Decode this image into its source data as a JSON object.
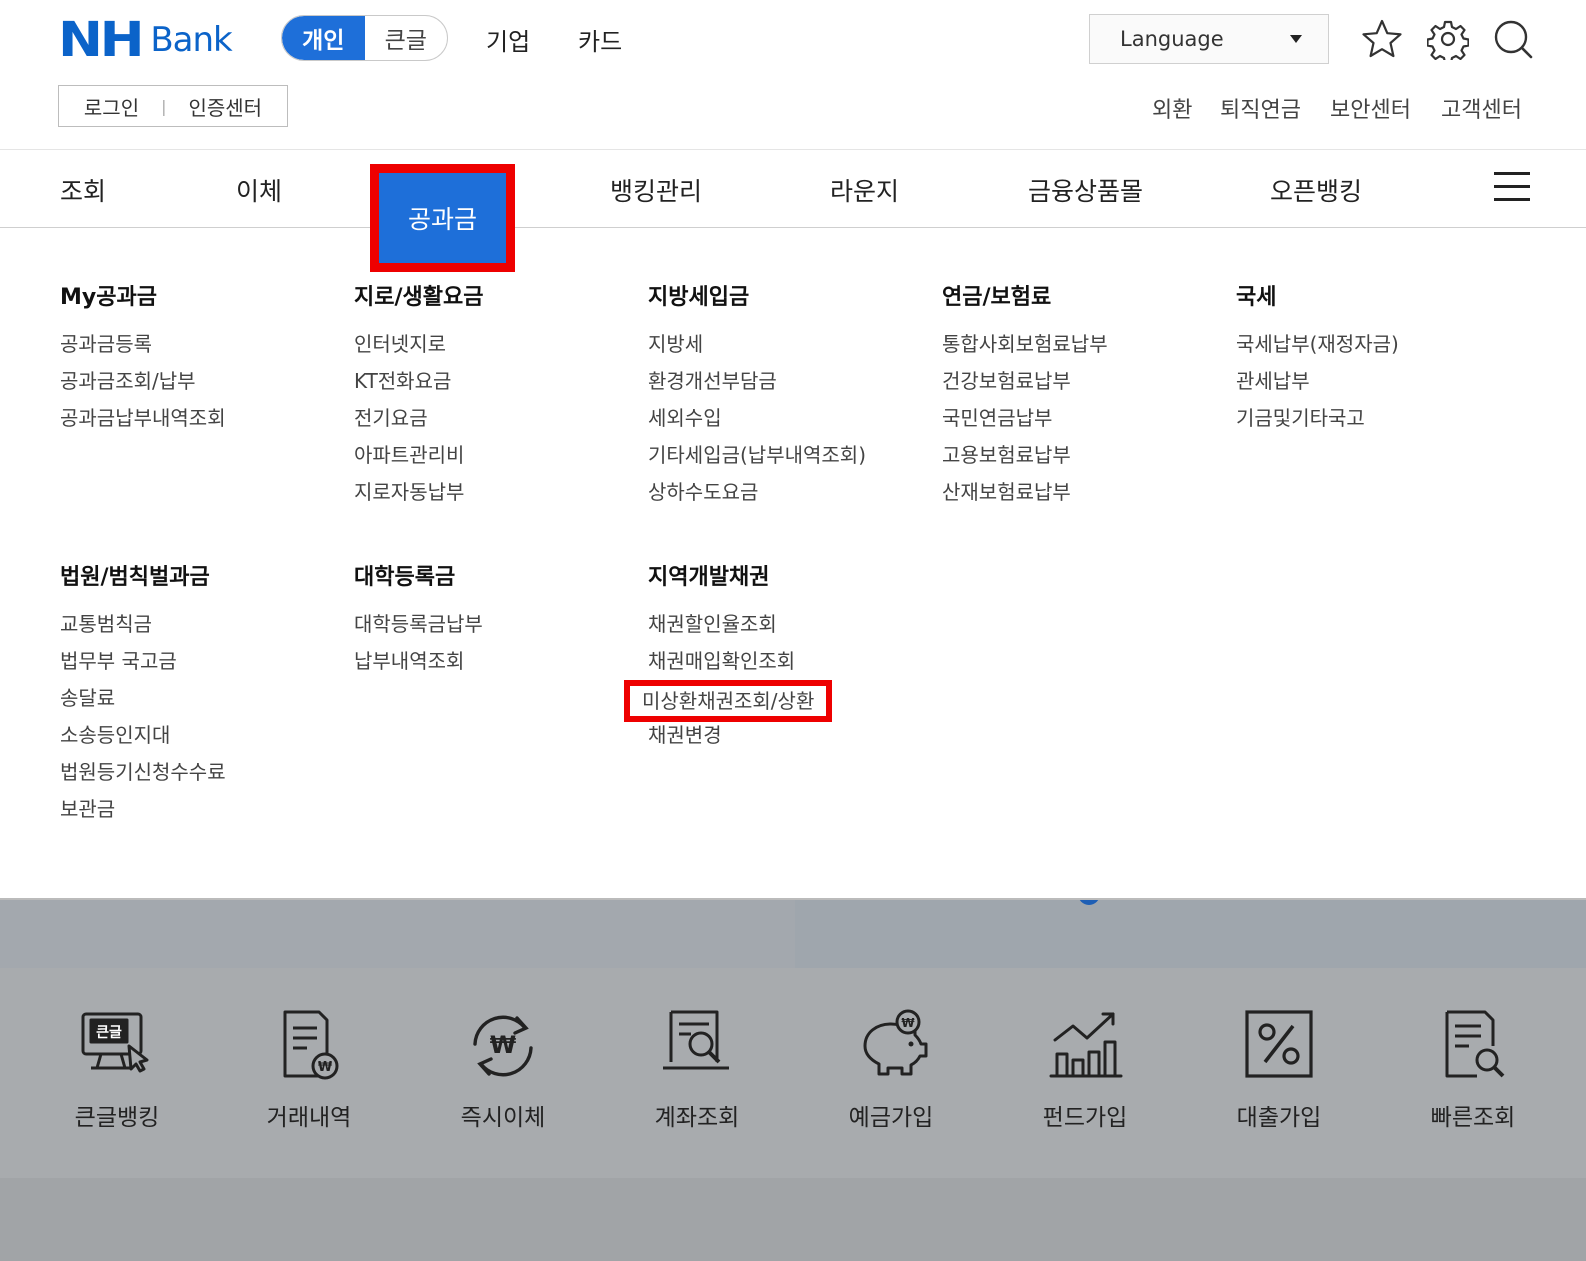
{
  "header": {
    "logo_nh": "NH",
    "logo_bank": "Bank",
    "segments": [
      "개인",
      "큰글"
    ],
    "top_nav": [
      "기업",
      "카드"
    ],
    "language": "Language",
    "icons": [
      "star-icon",
      "gear-icon",
      "search-icon"
    ],
    "login": "로그인",
    "cert_center": "인증센터",
    "util_links": [
      "외환",
      "퇴직연금",
      "보안센터",
      "고객센터"
    ]
  },
  "main_nav": {
    "items": [
      "조회",
      "이체",
      "공과금",
      "뱅킹관리",
      "라운지",
      "금융상품몰",
      "오픈뱅킹"
    ],
    "active": "공과금",
    "menu_icon": "hamburger-menu-icon"
  },
  "mega_menu": {
    "columns": [
      {
        "title": "My공과금",
        "items": [
          "공과금등록",
          "공과금조회/납부",
          "공과금납부내역조회"
        ]
      },
      {
        "title": "지로/생활요금",
        "items": [
          "인터넷지로",
          "KT전화요금",
          "전기요금",
          "아파트관리비",
          "지로자동납부"
        ]
      },
      {
        "title": "지방세입금",
        "items": [
          "지방세",
          "환경개선부담금",
          "세외수입",
          "기타세입금(납부내역조회)",
          "상하수도요금"
        ]
      },
      {
        "title": "연금/보험료",
        "items": [
          "통합사회보험료납부",
          "건강보험료납부",
          "국민연금납부",
          "고용보험료납부",
          "산재보험료납부"
        ]
      },
      {
        "title": "국세",
        "items": [
          "국세납부(재정자금)",
          "관세납부",
          "기금및기타국고"
        ]
      },
      {
        "title": "법원/범칙벌과금",
        "items": [
          "교통범칙금",
          "법무부 국고금",
          "송달료",
          "소송등인지대",
          "법원등기신청수수료",
          "보관금"
        ]
      },
      {
        "title": "대학등록금",
        "items": [
          "대학등록금납부",
          "납부내역조회"
        ]
      },
      {
        "title": "지역개발채권",
        "items": [
          "채권할인율조회",
          "채권매입확인조회",
          "미상환채권조회/상환",
          "채권변경"
        ]
      }
    ],
    "highlighted_item": "미상환채권조회/상환"
  },
  "quick_menu": [
    {
      "label": "큰글뱅킹",
      "icon": "large-text-monitor-icon"
    },
    {
      "label": "거래내역",
      "icon": "document-won-icon"
    },
    {
      "label": "즉시이체",
      "icon": "won-transfer-icon"
    },
    {
      "label": "계좌조회",
      "icon": "account-search-icon"
    },
    {
      "label": "예금가입",
      "icon": "piggy-bank-icon"
    },
    {
      "label": "펀드가입",
      "icon": "fund-chart-icon"
    },
    {
      "label": "대출가입",
      "icon": "percent-icon"
    },
    {
      "label": "빠른조회",
      "icon": "quick-search-icon"
    }
  ],
  "colors": {
    "brand_blue": "#1e6fd9",
    "highlight_red": "#ee0000",
    "overlay_gray": "#a8abae"
  }
}
